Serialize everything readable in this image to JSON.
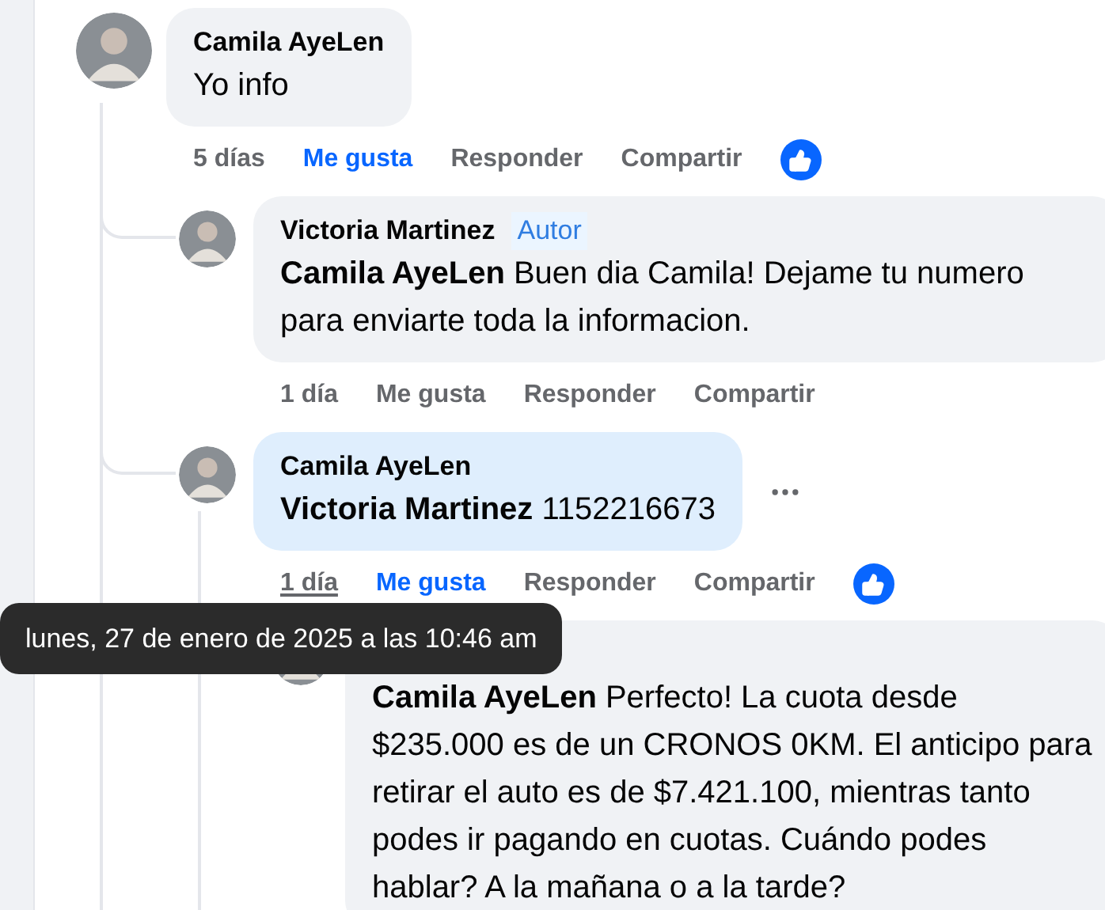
{
  "comments": [
    {
      "author": "Camila AyeLen",
      "text": "Yo info",
      "highlighted": false,
      "menu_shown": false,
      "time": {
        "label": "5 días",
        "hovered": false
      },
      "like": {
        "label": "Me gusta",
        "selected": true
      },
      "reply": "Responder",
      "share": "Compartir",
      "reaction_shown": true,
      "replies": [
        {
          "author": "Victoria Martinez",
          "author_badge": "Autor",
          "text": "**Camila AyeLen** Buen dia Camila! Dejame tu numero para enviarte toda la informacion.",
          "highlighted": false,
          "menu_shown": false,
          "time": {
            "label": "1 día",
            "hovered": false
          },
          "like": {
            "label": "Me gusta",
            "selected": false
          },
          "reply": "Responder",
          "share": "Compartir",
          "reaction_shown": false
        },
        {
          "author": "Camila AyeLen",
          "text": "**Victoria Martinez** 1152216673",
          "highlighted": true,
          "menu_shown": true,
          "time": {
            "label": "1 día",
            "hovered": true
          },
          "like": {
            "label": "Me gusta",
            "selected": true
          },
          "reply": "Responder",
          "share": "Compartir",
          "reaction_shown": true,
          "replies": [
            {
              "text": "**Camila AyeLen** Perfecto! La cuota desde $235.000 es de un CRONOS 0KM. El anticipo para retirar el auto es de $7.421.100, mientras tanto podes ir pagando en cuotas. Cuándo podes hablar? A la mañana o a la tarde?",
              "highlighted": false
            }
          ]
        }
      ]
    }
  ],
  "tooltip": "lunes, 27 de enero de 2025 a las 10:46 am"
}
